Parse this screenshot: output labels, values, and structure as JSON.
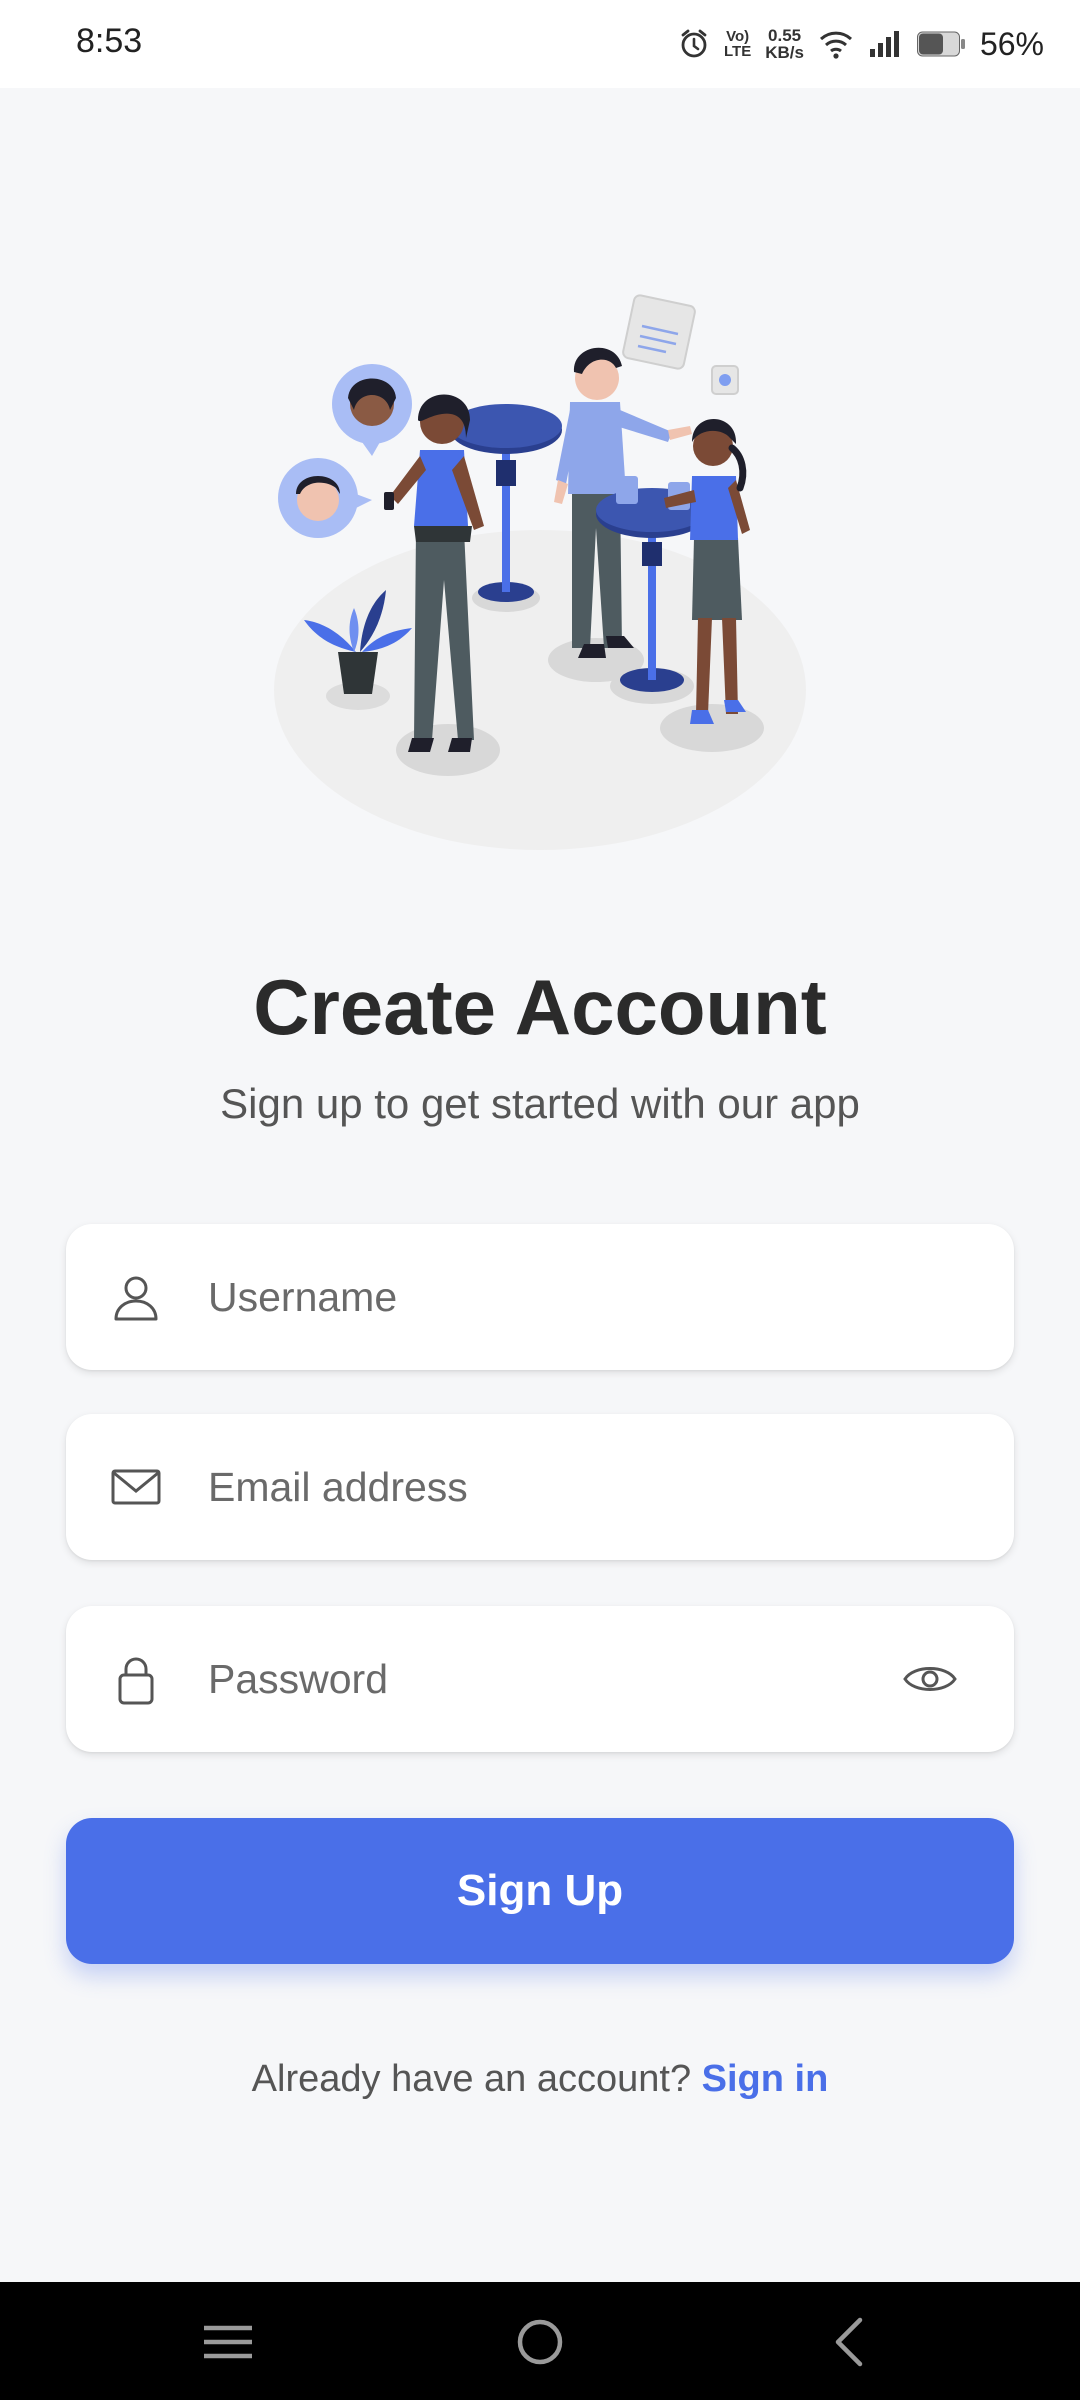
{
  "status_bar": {
    "time": "8:53",
    "volte_top": "Vo)",
    "volte_bottom": "LTE",
    "speed_value": "0.55",
    "speed_unit": "KB/s",
    "battery_percent": "56%",
    "icons": [
      "alarm-icon",
      "volte-icon",
      "wifi-icon",
      "signal-icon",
      "battery-icon"
    ]
  },
  "header": {
    "title": "Create Account",
    "subtitle": "Sign up to get started with our app"
  },
  "form": {
    "username_placeholder": "Username",
    "email_placeholder": "Email address",
    "password_placeholder": "Password",
    "submit_label": "Sign Up"
  },
  "footer": {
    "prompt": "Already have an account?",
    "signin_label": "Sign in"
  },
  "nav_bar": {
    "icons": [
      "menu-icon",
      "home-icon",
      "back-icon"
    ]
  },
  "colors": {
    "accent": "#4a6fe8",
    "background": "#f6f7f9",
    "title": "#2b2b2b",
    "illustration_blue": "#4a6fe8",
    "illustration_navy": "#2a3f8f"
  }
}
